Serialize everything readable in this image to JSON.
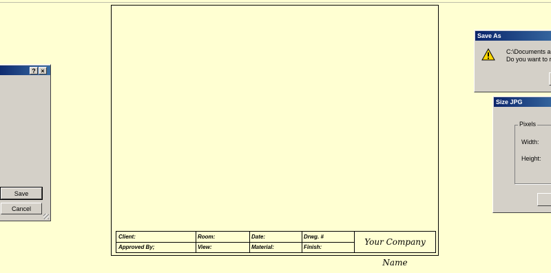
{
  "title_block": {
    "client_label": "Client:",
    "room_label": "Room:",
    "date_label": "Date:",
    "drawing_label": "Drwg. #",
    "approved_label": "Approved By;",
    "view_label": "View:",
    "material_label": "Material:",
    "finish_label": "Finish:",
    "company_name": "Your Company Name"
  },
  "left_dialog": {
    "help_glyph": "?",
    "close_glyph": "×",
    "save_label": "Save",
    "cancel_label": "Cancel"
  },
  "save_as_dialog": {
    "title": "Save As",
    "line1": "C:\\Documents a",
    "line2": "Do you want to r",
    "icon": "warning-icon"
  },
  "size_jpg_dialog": {
    "title": "Size JPG",
    "group_label": "Pixels",
    "width_label": "Width:",
    "height_label": "Height:"
  }
}
